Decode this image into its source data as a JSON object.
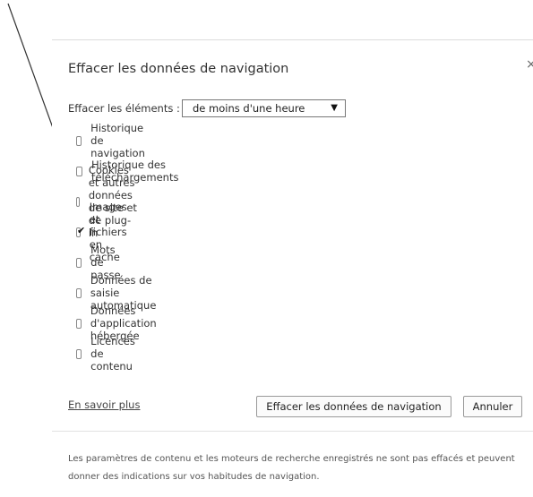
{
  "dialog": {
    "title": "Effacer les données de navigation",
    "close_symbol": "×",
    "range_label": "Effacer les éléments :",
    "range_selected": "de moins d'une heure",
    "checkboxes": [
      {
        "label": "Historique de navigation",
        "checked": false
      },
      {
        "label": "Historique des téléchargements",
        "checked": false
      },
      {
        "label": "Cookies et autres données de site et de plug-in",
        "checked": false
      },
      {
        "label": "Images et fichiers en cache",
        "checked": true
      },
      {
        "label": "Mots de passe",
        "checked": false
      },
      {
        "label": "Données de saisie automatique",
        "checked": false
      },
      {
        "label": "Données d'application hébergée",
        "checked": false
      },
      {
        "label": "Licences de contenu",
        "checked": false
      }
    ],
    "learn_more": "En savoir plus",
    "clear_button": "Effacer les données de navigation",
    "cancel_button": "Annuler",
    "footer_note": "Les paramètres de contenu et les moteurs de recherche enregistrés ne sont pas effacés et peuvent donner des indications sur vos habitudes de navigation."
  }
}
